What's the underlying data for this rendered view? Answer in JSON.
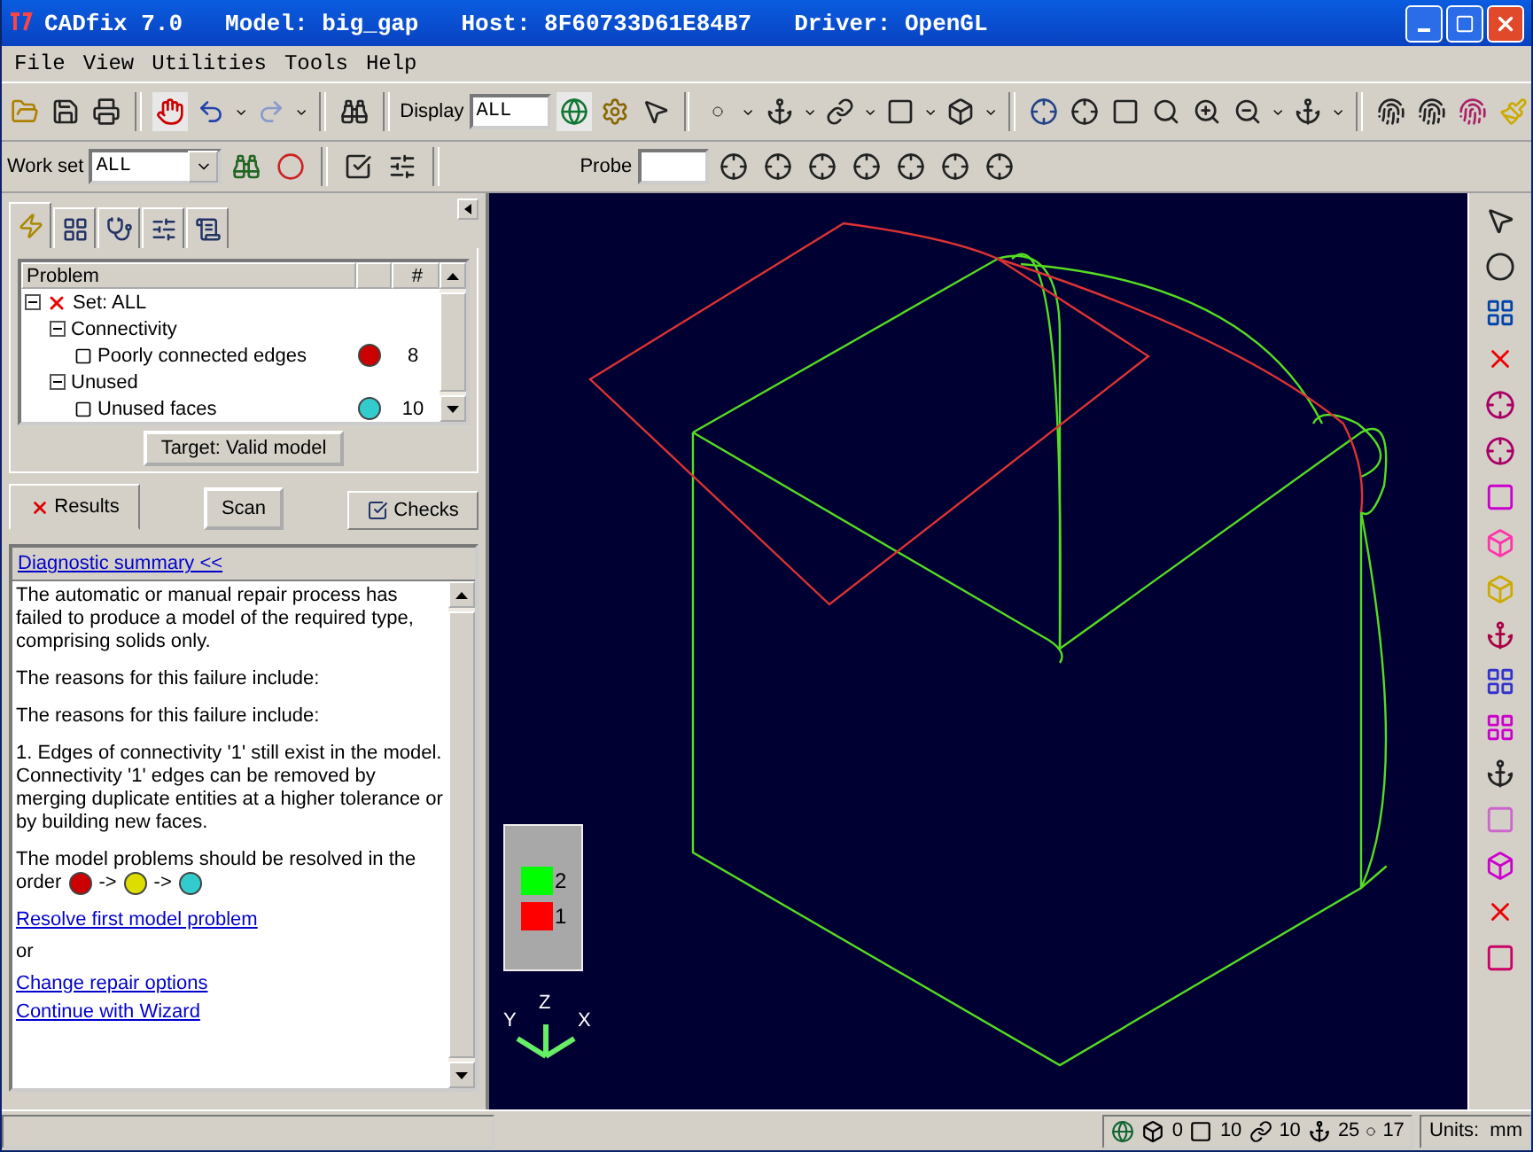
{
  "window": {
    "title_parts": [
      "CADfix 7.0",
      "Model: big_gap",
      "Host: 8F60733D61E84B7",
      "Driver: OpenGL"
    ]
  },
  "menu": [
    "File",
    "View",
    "Utilities",
    "Tools",
    "Help"
  ],
  "toolbar": {
    "display_label": "Display",
    "display_value": "ALL",
    "workset_label": "Work set",
    "workset_value": "ALL",
    "probe_label": "Probe"
  },
  "panel_tabs": [
    {
      "selected": true
    },
    {
      "selected": false
    },
    {
      "selected": false
    },
    {
      "selected": false
    },
    {
      "selected": false
    }
  ],
  "problem_table": {
    "column_1": "Problem",
    "column_3": "#",
    "tree": [
      {
        "label": "Set: ALL",
        "expanded": true,
        "children": [
          {
            "label": "Connectivity",
            "expanded": true,
            "children": [
              {
                "label": "Poorly connected edges",
                "color": "#cc0000",
                "count": "8"
              }
            ]
          },
          {
            "label": "Unused",
            "expanded": true,
            "children": [
              {
                "label": "Unused faces",
                "color": "#33cccc",
                "count": "10"
              }
            ]
          }
        ]
      }
    ]
  },
  "target_button": "Target: Valid model",
  "bottom_tabs": [
    {
      "label": "Results",
      "selected": true
    },
    {
      "label": "Checks",
      "selected": false
    }
  ],
  "scan_button": "Scan",
  "diagnostic": {
    "header_link": "Diagnostic summary <<",
    "paragraphs": [
      "The automatic or manual repair process has failed to produce a model of the required type, comprising solids only.",
      "The reasons for this failure include:",
      "The reasons for this failure include:",
      "1.  Edges of connectivity '1' still exist in the model. Connectivity '1' edges can be removed by merging duplicate entities at a higher tolerance or by building new faces.",
      "The model problems should be resolved in the"
    ],
    "order_label": "order",
    "order_arrow": "->",
    "order_dots": [
      {
        "color": "#cc0000"
      },
      {
        "color": "#dddd00"
      },
      {
        "color": "#33cccc"
      }
    ],
    "link_1": "Resolve first model problem",
    "or_text": "or",
    "link_2": "Change repair options",
    "link_3": "Continue with Wizard"
  },
  "legend": [
    {
      "label": "2",
      "color": "#00ff00"
    },
    {
      "label": "1",
      "color": "#ff0000"
    }
  ],
  "axes": {
    "y": "Y",
    "z": "Z",
    "x": "X"
  },
  "status_bar": {
    "counts": [
      "0",
      "10",
      "10",
      "25",
      "17"
    ],
    "units": "Units:  mm"
  }
}
